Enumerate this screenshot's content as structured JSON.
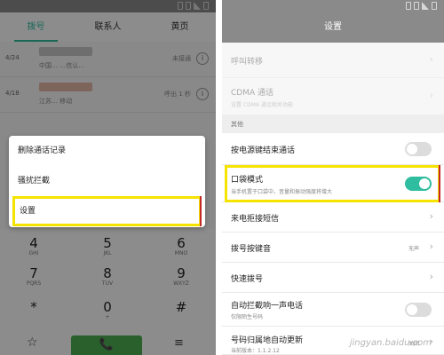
{
  "dialer": {
    "tabs": [
      "拨号",
      "联系人",
      "黄页"
    ],
    "calls": [
      {
        "date": "4/24",
        "sub": "中国…  …信认…",
        "tag": "未接通",
        "info": "i"
      },
      {
        "date": "4/18",
        "sub": "江苏…  移动",
        "tag": "呼出 1 秒",
        "info": "i"
      }
    ],
    "context_menu": [
      "删除通话记录",
      "骚扰拦截",
      "设置"
    ],
    "keypad": [
      {
        "digit": "4",
        "letters": "GHI"
      },
      {
        "digit": "5",
        "letters": "JKL"
      },
      {
        "digit": "6",
        "letters": "MNO"
      },
      {
        "digit": "7",
        "letters": "PQRS"
      },
      {
        "digit": "8",
        "letters": "TUV"
      },
      {
        "digit": "9",
        "letters": "WXYZ"
      },
      {
        "digit": "*",
        "letters": ""
      },
      {
        "digit": "0",
        "letters": "+"
      },
      {
        "digit": "#",
        "letters": ""
      }
    ],
    "bottom": {
      "star": "☆",
      "call": "📞",
      "menu": "≡"
    }
  },
  "settings": {
    "title": "设置",
    "rows": {
      "call_forward": {
        "label": "呼叫转移",
        "chevron": "›"
      },
      "cdma": {
        "label": "CDMA 通话",
        "desc": "设置 CDMA 通话相关功能",
        "chevron": "›"
      },
      "section_other": "其他",
      "power_end_call": {
        "label": "按电源键结束通话"
      },
      "pocket_mode": {
        "label": "口袋模式",
        "desc": "当手机置于口袋中，音量和振动强度将增大"
      },
      "reject_sms": {
        "label": "来电拒接短信",
        "chevron": "›"
      },
      "dial_tone": {
        "label": "拨号按键音",
        "value": "无声",
        "chevron": "›"
      },
      "speed_dial": {
        "label": "快速拨号",
        "chevron": "›"
      },
      "block_ring": {
        "label": "自动拦截响一声电话",
        "desc": "仅限陌生号码"
      },
      "location_update": {
        "label": "号码归属地自动更新",
        "desc": "当前版本：1.1.2.12",
        "value": "关闭",
        "chevron": "›"
      }
    },
    "toggles": {
      "power_end_call": false,
      "pocket_mode": true,
      "block_ring": false
    }
  },
  "watermark": "jingyan.baidu.com",
  "colors": {
    "accent": "#2ebd9e",
    "highlight": "#f5e400",
    "call_green": "#4caf50"
  }
}
